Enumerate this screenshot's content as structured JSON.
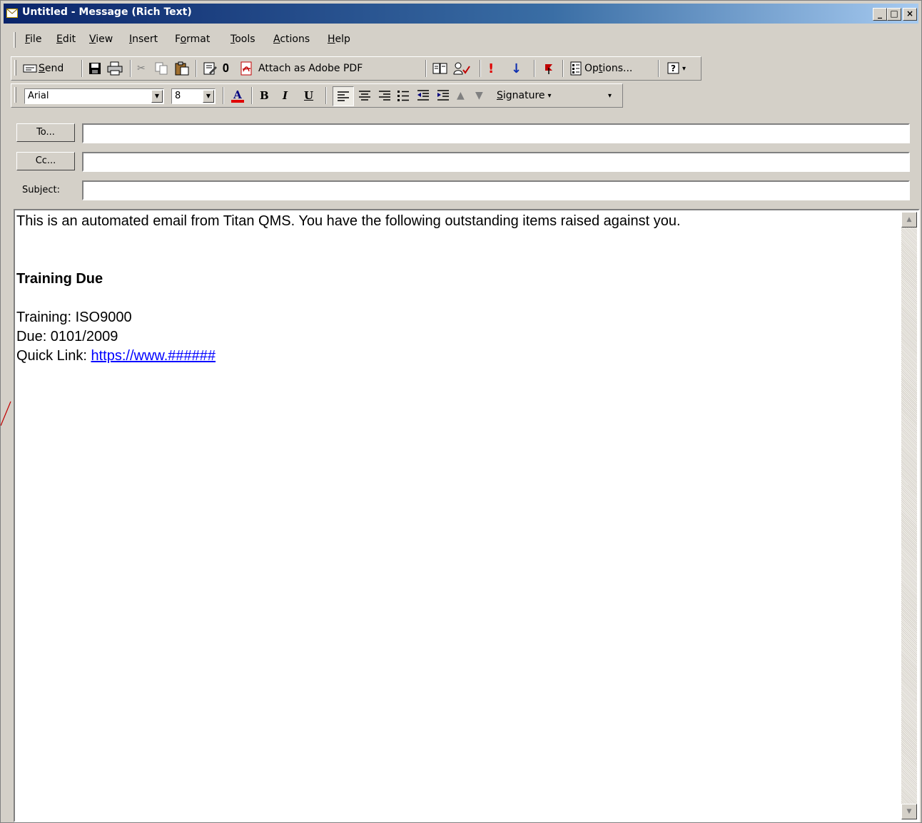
{
  "window": {
    "title": "Untitled - Message (Rich Text)",
    "controls": {
      "minimize": "_",
      "maximize": "□",
      "close": "×"
    }
  },
  "menubar": {
    "items": [
      {
        "label": "File",
        "hotkey": "F",
        "rest": "ile"
      },
      {
        "label": "Edit",
        "hotkey": "E",
        "rest": "dit"
      },
      {
        "label": "View",
        "hotkey": "V",
        "rest": "iew"
      },
      {
        "label": "Insert",
        "hotkey": "I",
        "rest": "nsert"
      },
      {
        "label": "Format",
        "pre": "F",
        "hotkey": "o",
        "rest": "rmat"
      },
      {
        "label": "Tools",
        "hotkey": "T",
        "rest": "ools"
      },
      {
        "label": "Actions",
        "hotkey": "A",
        "rest": "ctions"
      },
      {
        "label": "Help",
        "hotkey": "H",
        "rest": "elp"
      }
    ]
  },
  "toolbar_standard": {
    "send": {
      "hotkey": "S",
      "rest": "end"
    },
    "attach_pdf": "Attach as Adobe PDF",
    "options": {
      "pre": "Op",
      "hotkey": "t",
      "rest": "ions..."
    }
  },
  "toolbar_format": {
    "font": "Arial",
    "size": "8",
    "signature": {
      "hotkey": "S",
      "rest": "ignature"
    }
  },
  "header": {
    "to_label": "To...",
    "cc_label": "Cc...",
    "subject_label": "Subject:",
    "to_value": "",
    "cc_value": "",
    "subject_value": ""
  },
  "message": {
    "intro": "This is an automated email from Titan QMS.  You have the following outstanding items raised against you.",
    "heading": "Training Due",
    "training": "Training: ISO9000",
    "due": "Due: 0101/2009",
    "quick_link_label": "Quick Link: ",
    "quick_link_url": "https://www.######"
  },
  "colors": {
    "title_gradient_start": "#0a246a",
    "title_gradient_end": "#a6caf0",
    "chrome": "#d4d0c8",
    "link": "#0000ff",
    "importance_high": "#e00000",
    "importance_low": "#1030b0"
  }
}
